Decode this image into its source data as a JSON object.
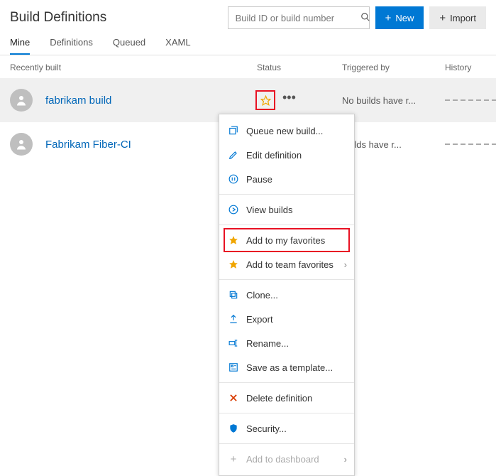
{
  "page_title": "Build Definitions",
  "search": {
    "placeholder": "Build ID or build number"
  },
  "buttons": {
    "new": "New",
    "import": "Import"
  },
  "tabs": [
    "Mine",
    "Definitions",
    "Queued",
    "XAML"
  ],
  "active_tab": 0,
  "columns": {
    "name": "Recently built",
    "status": "Status",
    "triggered": "Triggered by",
    "history": "History"
  },
  "rows": [
    {
      "name": "fabrikam build",
      "triggered": "No builds have r..."
    },
    {
      "name": "Fabrikam Fiber-CI",
      "triggered": "builds have r..."
    }
  ],
  "menu": {
    "queue": "Queue new build...",
    "edit": "Edit definition",
    "pause": "Pause",
    "view": "View builds",
    "fav_my": "Add to my favorites",
    "fav_team": "Add to team favorites",
    "clone": "Clone...",
    "export": "Export",
    "rename": "Rename...",
    "save_tmpl": "Save as a template...",
    "delete": "Delete definition",
    "security": "Security...",
    "dashboard": "Add to dashboard"
  }
}
